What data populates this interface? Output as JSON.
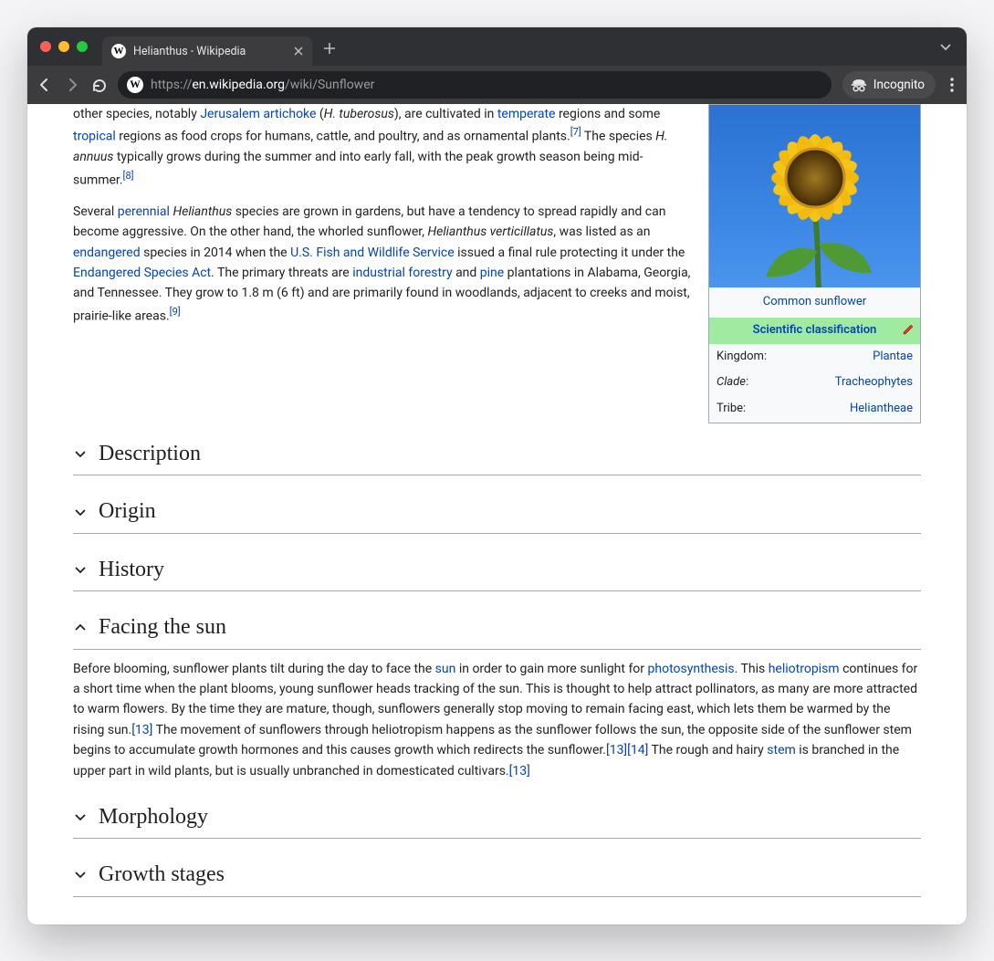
{
  "browser": {
    "tab_title": "Helianthus - Wikipedia",
    "url_host": "en.wikipedia.org",
    "url_path": "/wiki/Sunflower",
    "incognito_label": "Incognito"
  },
  "article": {
    "intro": {
      "p1_pre": "other species, notably ",
      "p1_link_ja": "Jerusalem artichoke",
      "p1_paren_open": " (",
      "p1_ital_ht": "H. tuberosus",
      "p1_paren_close": "), are cultivated in ",
      "p1_link_temperate": "temperate",
      "p1_after_temperate": " regions and some ",
      "p1_link_tropical": "tropical",
      "p1_after_tropical": " regions as food crops for humans, cattle, and poultry, and as ornamental plants.",
      "p1_ref7": "[7]",
      "p1_sentence2_open": " The species ",
      "p1_ital_ha": "H. annuus",
      "p1_sentence2_rest": " typically grows during the summer and into early fall, with the peak growth season being mid-summer.",
      "p1_ref8": "[8]",
      "p2_open": "Several ",
      "p2_link_perennial": "perennial",
      "p2_space": " ",
      "p2_ital_helianthus": "Helianthus",
      "p2_after": " species are grown in gardens, but have a tendency to spread rapidly and can become aggressive. On the other hand, the whorled sunflower, ",
      "p2_ital_vert": "Helianthus verticillatus",
      "p2_after_vert": ", was listed as an ",
      "p2_link_endangered": "endangered",
      "p2_mid": " species in 2014 when the ",
      "p2_link_usfws": "U.S. Fish and Wildlife Service",
      "p2_after_usfws": " issued a final rule protecting it under the ",
      "p2_link_esa": "Endangered Species Act",
      "p2_after_esa": ". The primary threats are ",
      "p2_link_if": "industrial forestry",
      "p2_and": " and ",
      "p2_link_pine": "pine",
      "p2_after_pine": " plantations in Alabama, Georgia, and Tennessee. They grow to 1.8 m (6 ft) and are primarily found in woodlands, adjacent to creeks and moist, prairie-like areas.",
      "p2_ref9": "[9]"
    },
    "infobox": {
      "caption": "Common sunflower",
      "sci_class": "Scientific classification",
      "rows": [
        {
          "k": "Kingdom:",
          "v": "Plantae",
          "ital": false
        },
        {
          "k": "Clade:",
          "v": "Tracheophytes",
          "ital": true
        },
        {
          "k": "Tribe:",
          "v": "Heliantheae",
          "ital": false
        }
      ]
    },
    "sections": {
      "description": {
        "title": "Description",
        "open": false
      },
      "origin": {
        "title": "Origin",
        "open": false
      },
      "history": {
        "title": "History",
        "open": false
      },
      "facing": {
        "title": "Facing the sun",
        "open": true,
        "t1": "Before blooming, sunflower plants tilt during the day to face the ",
        "link_sun": "sun",
        "t2": " in order to gain more sunlight for ",
        "link_photo": "photosynthesis",
        "t3": ". This ",
        "link_helio": "heliotropism",
        "t4": " continues for a short time when the plant blooms, young sunflower heads tracking of the sun. This is thought to help attract pollinators, as many are more attracted to warm flowers. By the time they are mature, though, sunflowers generally stop moving to remain facing east, which lets them be warmed by the rising sun.",
        "ref13a": "[13]",
        "t5": " The movement of sunflowers through heliotropism happens as the sunflower follows the sun, the opposite side of the sunflower stem begins to accumulate growth hormones and this causes growth which redirects the sunflower.",
        "ref13b": "[13]",
        "ref14": "[14]",
        "t6": " The rough and hairy ",
        "link_stem": "stem",
        "t7": " is branched in the upper part in wild plants, but is usually unbranched in domesticated cultivars.",
        "ref13c": "[13]"
      },
      "morphology": {
        "title": "Morphology",
        "open": false
      },
      "growth": {
        "title": "Growth stages",
        "open": false
      }
    }
  }
}
